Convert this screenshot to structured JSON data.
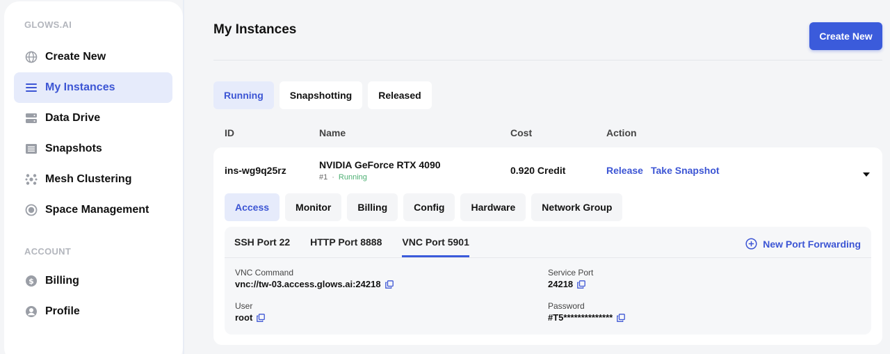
{
  "brand": "GLOWS.AI",
  "sidebar": {
    "items": [
      {
        "label": "Create New",
        "icon": "globe-icon"
      },
      {
        "label": "My Instances",
        "icon": "list-icon",
        "active": true
      },
      {
        "label": "Data Drive",
        "icon": "drive-icon"
      },
      {
        "label": "Snapshots",
        "icon": "snapshot-icon"
      },
      {
        "label": "Mesh Clustering",
        "icon": "mesh-icon"
      },
      {
        "label": "Space Management",
        "icon": "space-icon"
      }
    ],
    "account_label": "ACCOUNT",
    "account_items": [
      {
        "label": "Billing",
        "icon": "dollar-icon"
      },
      {
        "label": "Profile",
        "icon": "user-icon"
      }
    ]
  },
  "header": {
    "title": "My Instances",
    "create_button": "Create New"
  },
  "status_tabs": [
    {
      "label": "Running",
      "active": true
    },
    {
      "label": "Snapshotting"
    },
    {
      "label": "Released"
    }
  ],
  "columns": {
    "id": "ID",
    "name": "Name",
    "cost": "Cost",
    "action": "Action"
  },
  "instance": {
    "id": "ins-wg9q25rz",
    "name": "NVIDIA GeForce RTX 4090",
    "index": "#1",
    "status": "Running",
    "cost": "0.920 Credit",
    "actions": {
      "release": "Release",
      "snapshot": "Take Snapshot"
    },
    "tabs": [
      {
        "label": "Access",
        "active": true
      },
      {
        "label": "Monitor"
      },
      {
        "label": "Billing"
      },
      {
        "label": "Config"
      },
      {
        "label": "Hardware"
      },
      {
        "label": "Network Group"
      }
    ],
    "ports": [
      {
        "label": "SSH Port 22"
      },
      {
        "label": "HTTP Port 8888"
      },
      {
        "label": "VNC Port 5901",
        "active": true
      }
    ],
    "new_port_forwarding": "New Port Forwarding",
    "fields": {
      "vnc_command_label": "VNC Command",
      "vnc_command": "vnc://tw-03.access.glows.ai:24218",
      "service_port_label": "Service Port",
      "service_port": "24218",
      "user_label": "User",
      "user": "root",
      "password_label": "Password",
      "password": "#T5**************"
    }
  },
  "colors": {
    "accent": "#3b5bdb",
    "active_bg": "#e6ebfb",
    "running_green": "#4caf72"
  }
}
